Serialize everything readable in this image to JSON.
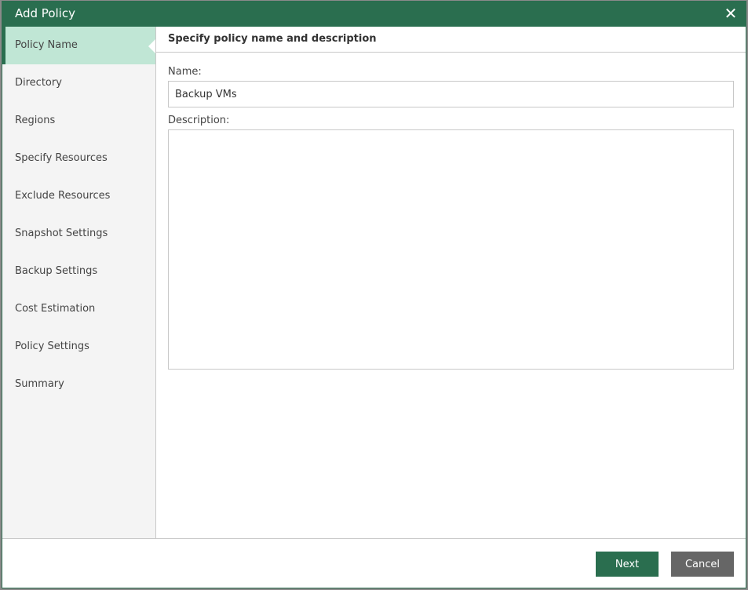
{
  "dialog": {
    "title": "Add Policy",
    "close_icon": "close-icon"
  },
  "sidebar": {
    "items": [
      {
        "label": "Policy Name",
        "active": true
      },
      {
        "label": "Directory"
      },
      {
        "label": "Regions"
      },
      {
        "label": "Specify Resources"
      },
      {
        "label": "Exclude Resources"
      },
      {
        "label": "Snapshot Settings"
      },
      {
        "label": "Backup Settings"
      },
      {
        "label": "Cost Estimation"
      },
      {
        "label": "Policy Settings"
      },
      {
        "label": "Summary"
      }
    ]
  },
  "main": {
    "header": "Specify policy name and description",
    "name_label": "Name:",
    "name_value": "Backup VMs",
    "description_label": "Description:",
    "description_value": ""
  },
  "footer": {
    "next_label": "Next",
    "cancel_label": "Cancel"
  },
  "colors": {
    "accent": "#2a6e4f",
    "active_nav": "#c0e6d5",
    "cancel": "#666666"
  }
}
